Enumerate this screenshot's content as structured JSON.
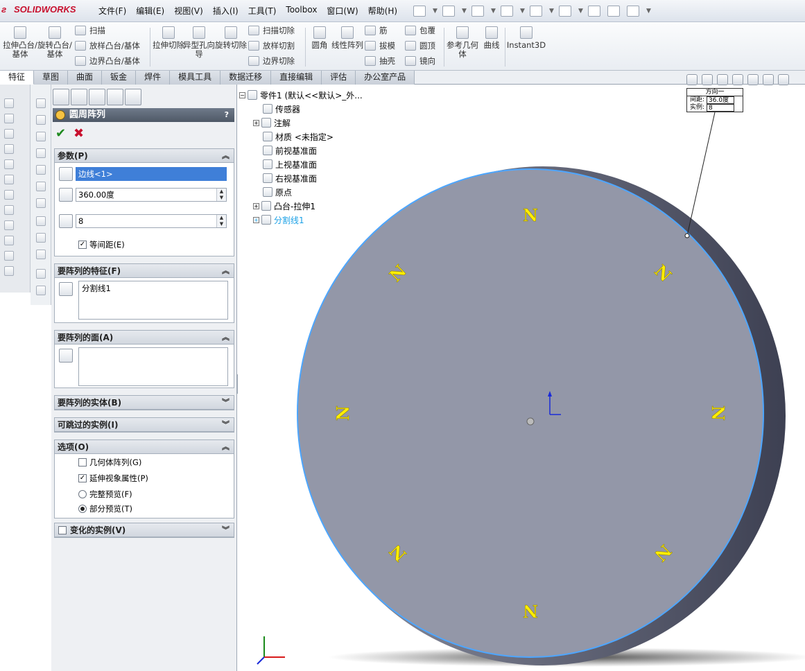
{
  "app": {
    "logo_text": "SOLIDWORKS",
    "menu": [
      "文件(F)",
      "编辑(E)",
      "视图(V)",
      "插入(I)",
      "工具(T)",
      "Toolbox",
      "窗口(W)",
      "帮助(H)"
    ]
  },
  "command_manager": {
    "big_buttons": [
      {
        "label": "拉伸凸台/基体"
      },
      {
        "label": "旋转凸台/基体"
      },
      {
        "label": "拉伸切除"
      },
      {
        "label": "异型孔向导"
      },
      {
        "label": "旋转切除"
      },
      {
        "label": "圆角"
      },
      {
        "label": "线性阵列"
      },
      {
        "label": "参考几何体"
      },
      {
        "label": "曲线"
      },
      {
        "label": "Instant3D"
      }
    ],
    "small_buttons": {
      "sweep": "扫描",
      "loft": "放样凸台/基体",
      "boundary": "边界凸台/基体",
      "swept_cut": "扫描切除",
      "lofted_cut": "放样切割",
      "boundary_cut": "边界切除",
      "rib": "筋",
      "draft": "拔模",
      "shell": "抽壳",
      "wrap": "包覆",
      "dome": "圆顶",
      "mirror": "镜向"
    }
  },
  "tabs": [
    "特征",
    "草图",
    "曲面",
    "钣金",
    "焊件",
    "模具工具",
    "数据迁移",
    "直接编辑",
    "评估",
    "办公室产品"
  ],
  "active_tab": "特征",
  "property_manager": {
    "title": "圆周阵列",
    "help": "?",
    "parameters": {
      "header": "参数(P)",
      "axis_value": "边线<1>",
      "angle_value": "360.00度",
      "instances_value": "8",
      "equal_spacing_label": "等间距(E)",
      "equal_spacing_checked": true
    },
    "features_to_pattern": {
      "header": "要阵列的特征(F)",
      "items": [
        "分割线1"
      ]
    },
    "faces_to_pattern": {
      "header": "要阵列的面(A)"
    },
    "bodies_to_pattern": {
      "header": "要阵列的实体(B)"
    },
    "instances_to_skip": {
      "header": "可跳过的实例(I)"
    },
    "options": {
      "header": "选项(O)",
      "geometry_pattern": "几何体阵列(G)",
      "propagate_visual": "延伸视象属性(P)",
      "full_preview": "完整预览(F)",
      "partial_preview": "部分预览(T)"
    },
    "varied_instances": {
      "header": "变化的实例(V)"
    }
  },
  "feature_tree": {
    "root": "零件1 (默认<<默认>_外...",
    "items": [
      {
        "label": "传感器"
      },
      {
        "label": "注解"
      },
      {
        "label": "材质 <未指定>"
      },
      {
        "label": "前视基准面"
      },
      {
        "label": "上视基准面"
      },
      {
        "label": "右视基准面"
      },
      {
        "label": "原点"
      },
      {
        "label": "凸台-拉伸1"
      },
      {
        "label": "分割线1"
      }
    ]
  },
  "callout": {
    "title": "方向一",
    "spacing_label": "间距:",
    "spacing_value": "36.0度",
    "instances_label": "实例:",
    "instances_value": "8"
  },
  "model": {
    "marks": [
      "N",
      "N",
      "N",
      "N",
      "N",
      "N",
      "N",
      "N"
    ],
    "disk_color": "#9397a8",
    "edge_color": "#4da6ff",
    "mark_color": "#ffee00"
  }
}
